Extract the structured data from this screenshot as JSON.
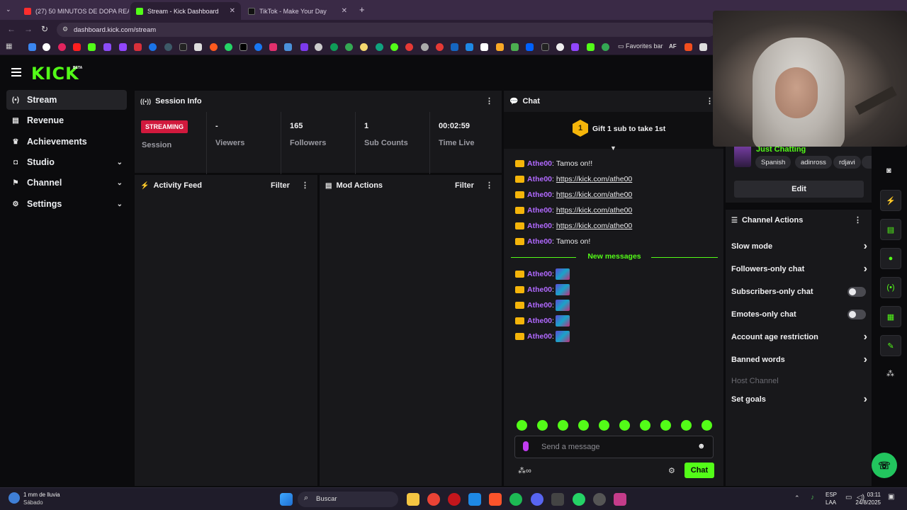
{
  "browser": {
    "tabs": [
      {
        "label": "(27) 50 MINUTOS DE DOPA REACCIONA",
        "color": "#ff2d2d",
        "active": false
      },
      {
        "label": "Stream - Kick Dashboard",
        "color": "#53fc18",
        "active": true
      },
      {
        "label": "TikTok - Make Your Day",
        "color": "#111111",
        "active": false
      }
    ],
    "url": "dashboard.kick.com/stream",
    "favorites_label": "Favorites bar",
    "favorites_extra": "AF"
  },
  "app": {
    "logo": "KICK",
    "logo_badge": "BETA"
  },
  "sidebar": {
    "items": [
      {
        "label": "Stream",
        "icon": "broadcast-icon",
        "glyph": "(•)",
        "active": true,
        "chevron": false
      },
      {
        "label": "Revenue",
        "icon": "chart-icon",
        "glyph": "▤",
        "active": false,
        "chevron": false
      },
      {
        "label": "Achievements",
        "icon": "trophy-icon",
        "glyph": "♛",
        "active": false,
        "chevron": false
      },
      {
        "label": "Studio",
        "icon": "camera-icon",
        "glyph": "◘",
        "active": false,
        "chevron": true
      },
      {
        "label": "Channel",
        "icon": "channel-icon",
        "glyph": "⚑",
        "active": false,
        "chevron": true
      },
      {
        "label": "Settings",
        "icon": "gear-icon",
        "glyph": "⚙",
        "active": false,
        "chevron": true
      }
    ]
  },
  "session": {
    "title": "Session Info",
    "status": "STREAMING",
    "status_label": "Session",
    "stats": [
      {
        "value": "-",
        "label": "Viewers"
      },
      {
        "value": "165",
        "label": "Followers"
      },
      {
        "value": "1",
        "label": "Sub Counts"
      },
      {
        "value": "00:02:59",
        "label": "Time Live"
      }
    ]
  },
  "activity": {
    "title": "Activity Feed",
    "filter": "Filter"
  },
  "mod": {
    "title": "Mod Actions",
    "filter": "Filter"
  },
  "chat": {
    "title": "Chat",
    "gift_rank": "1",
    "gift_text": "Gift 1 sub to take 1st",
    "new_messages": "New messages",
    "messages": [
      {
        "user": "Athe00",
        "text": "Tamos on!!",
        "link": false
      },
      {
        "user": "Athe00",
        "text": "https://kick.com/athe00",
        "link": true
      },
      {
        "user": "Athe00",
        "text": "https://kick.com/athe00",
        "link": true
      },
      {
        "user": "Athe00",
        "text": "https://kick.com/athe00",
        "link": true
      },
      {
        "user": "Athe00",
        "text": "https://kick.com/athe00",
        "link": true
      },
      {
        "user": "Athe00",
        "text": "Tamos on!",
        "link": false
      }
    ],
    "emote_messages": [
      {
        "user": "Athe00"
      },
      {
        "user": "Athe00"
      },
      {
        "user": "Athe00"
      },
      {
        "user": "Athe00"
      },
      {
        "user": "Athe00"
      }
    ],
    "placeholder": "Send a message",
    "send_label": "Chat",
    "quick_emotes": 10
  },
  "stream_info": {
    "category": "Just Chatting",
    "tags": [
      "Spanish",
      "adinross",
      "rdjavi"
    ],
    "edit_label": "Edit"
  },
  "channel_actions": {
    "title": "Channel Actions",
    "items": [
      {
        "label": "Slow mode",
        "kind": "arrow"
      },
      {
        "label": "Followers-only chat",
        "kind": "arrow"
      },
      {
        "label": "Subscribers-only chat",
        "kind": "toggle"
      },
      {
        "label": "Emotes-only chat",
        "kind": "toggle"
      },
      {
        "label": "Account age restriction",
        "kind": "arrow"
      },
      {
        "label": "Banned words",
        "kind": "arrow"
      },
      {
        "label": "Host Channel",
        "kind": "disabled"
      },
      {
        "label": "Set goals",
        "kind": "arrow"
      }
    ]
  },
  "taskbar": {
    "weather": "1 mm de lluvia",
    "weather_day": "Sábado",
    "search": "Buscar",
    "lang1": "ESP",
    "lang2": "LAA",
    "time": "03:11",
    "date": "24/8/2025"
  }
}
